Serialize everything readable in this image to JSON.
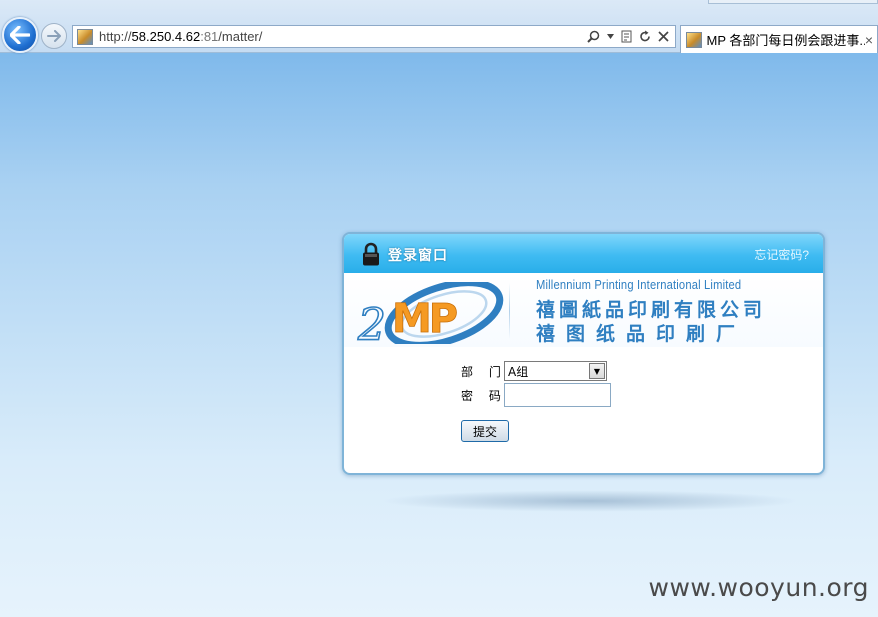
{
  "browser": {
    "url_scheme": "http://",
    "url_host": "58.250.4.62",
    "url_rest_port": ":81",
    "url_path": "/matter/",
    "tab_title": "MP 各部门每日例会跟进事...",
    "tab_close": "×",
    "icons": [
      "back-arrow-icon",
      "forward-arrow-icon",
      "search-icon",
      "dropdown-icon",
      "compat-view-icon",
      "refresh-icon",
      "stop-icon"
    ]
  },
  "login": {
    "header_title": "登录窗口",
    "forgot_link": "忘记密码?",
    "company_en": "Millennium Printing International Limited",
    "company_cn_trad": "禧圖紙品印刷有限公司",
    "company_cn_simp": "禧图纸品印刷厂",
    "logo_text": "MP",
    "logo_number": "2",
    "department_label": "部 门:",
    "department_value": "A组",
    "password_label": "密 码:",
    "password_value": "",
    "submit_label": "提交"
  },
  "watermark": "www.wooyun.org",
  "colors": {
    "header_blue": "#3fbbf2",
    "logo_orange": "#f59a23",
    "logo_blue": "#2f7fc1"
  }
}
